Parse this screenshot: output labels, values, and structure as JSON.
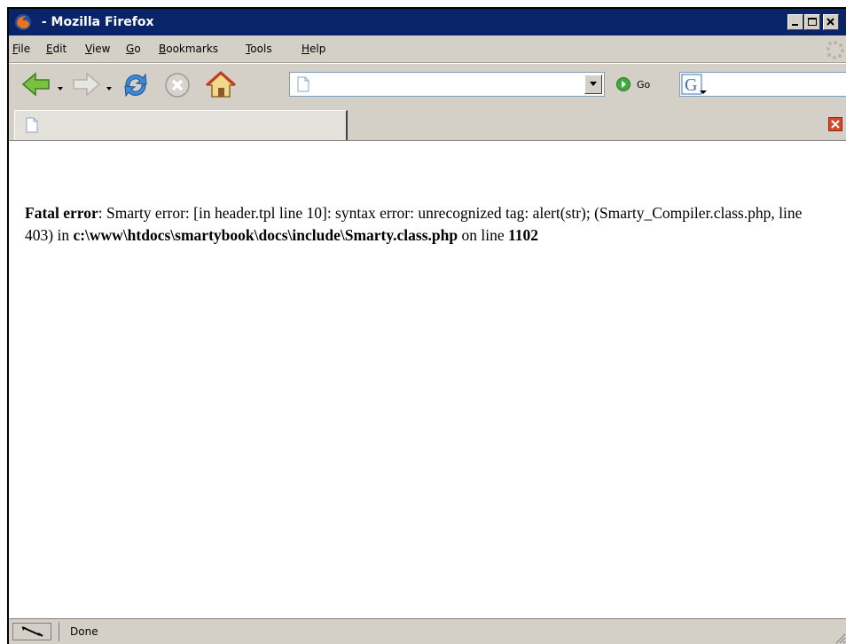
{
  "window": {
    "title": " - Mozilla Firefox"
  },
  "menubar": {
    "items": [
      {
        "first": "F",
        "rest": "ile"
      },
      {
        "first": "E",
        "rest": "dit"
      },
      {
        "first": "V",
        "rest": "iew"
      },
      {
        "first": "G",
        "rest": "o"
      },
      {
        "first": "B",
        "rest": "ookmarks"
      },
      {
        "first": "T",
        "rest": "ools"
      },
      {
        "first": "H",
        "rest": "elp"
      }
    ]
  },
  "navbar": {
    "url_value": "",
    "go_label": "Go",
    "search_value": ""
  },
  "tabbar": {
    "tab_title": ""
  },
  "content": {
    "error_heading": "Fatal error",
    "error_message": ": Smarty error: [in header.tpl line 10]: syntax error: unrecognized tag: alert(str); (Smarty_Compiler.class.php, line 403) in ",
    "error_file": "c:\\www\\htdocs\\smartybook\\docs\\include\\Smarty.class.php",
    "error_online": " on line ",
    "error_line": "1102"
  },
  "statusbar": {
    "text": "Done"
  }
}
